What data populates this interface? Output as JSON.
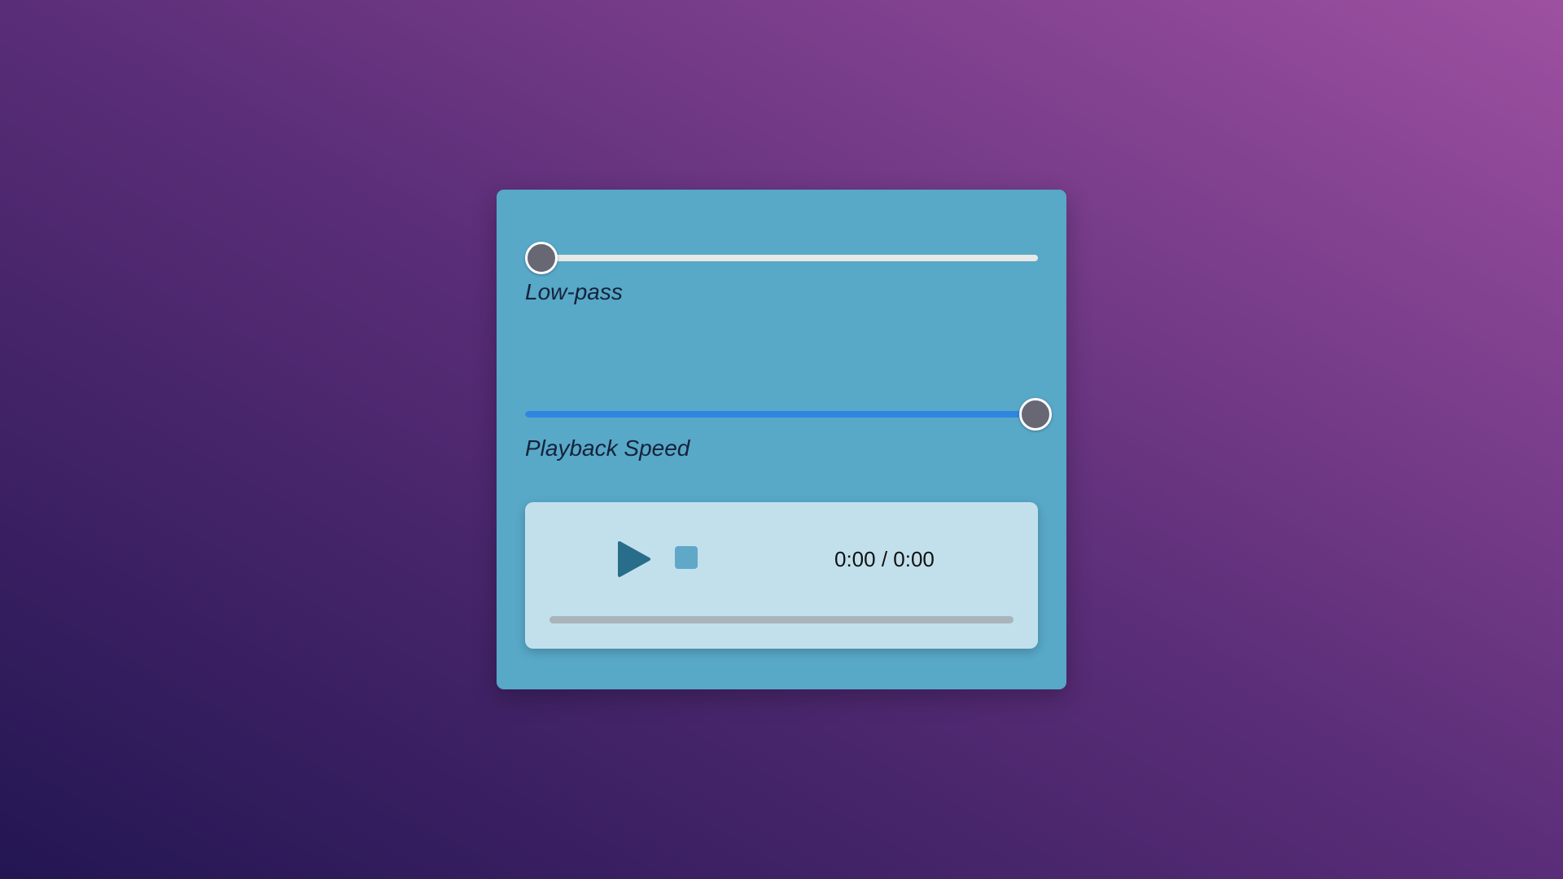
{
  "panel": {
    "lowpass": {
      "label": "Low-pass",
      "value_fraction": 0.0
    },
    "playback_speed": {
      "label": "Playback Speed",
      "value_fraction": 1.0
    }
  },
  "player": {
    "time_display": "0:00 / 0:00",
    "progress_fraction": 0.0,
    "play_icon": "play-icon",
    "stop_icon": "stop-icon"
  },
  "colors": {
    "panel_bg": "#58a8c8",
    "player_bg": "#c2e0ec",
    "slider_fill": "#2f86e0",
    "thumb": "#686874",
    "play_icon": "#286d8a"
  }
}
